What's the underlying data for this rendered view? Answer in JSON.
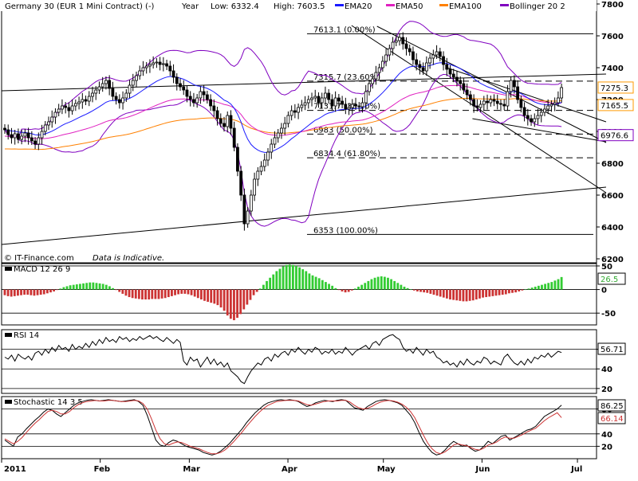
{
  "header": {
    "instrument": "Germany 30 (EUR 1 Mini Contract) (-)",
    "period": "Year",
    "low": "Low: 6332.4",
    "high": "High: 7603.5",
    "legend": [
      {
        "label": "EMA20",
        "color": "#1a1aff"
      },
      {
        "label": "EMA50",
        "color": "#e020c0"
      },
      {
        "label": "EMA100",
        "color": "#ff8000"
      },
      {
        "label": "Bollinger 20 2",
        "color": "#8000c0"
      }
    ]
  },
  "footer_text": {
    "copyright": "© IT-Finance.com",
    "disclaimer": "Data is Indicative."
  },
  "x_axis": {
    "labels": [
      {
        "text": "2011",
        "x": 0
      },
      {
        "text": "Feb",
        "x": 31
      },
      {
        "text": "Mar",
        "x": 59
      },
      {
        "text": "Apr",
        "x": 90
      },
      {
        "text": "May",
        "x": 120
      },
      {
        "text": "Jun",
        "x": 151
      },
      {
        "text": "Jul",
        "x": 181
      }
    ]
  },
  "chart_data": [
    {
      "type": "candlestick",
      "name": "price",
      "x_unit": "days since Jan 1 2011",
      "ylim": [
        6200,
        7800
      ],
      "yticks": [
        6200,
        6400,
        6600,
        6800,
        7000,
        7200,
        7400,
        7600,
        7800
      ],
      "price_labels": [
        {
          "text": "7275.3",
          "value": 7275.3,
          "color": "#ff9900"
        },
        {
          "text": "7165.5",
          "value": 7165.5,
          "color": "#ff9900"
        },
        {
          "text": "6976.6",
          "value": 6976.6,
          "color": "#8000c0"
        }
      ],
      "fib_levels": [
        {
          "label": "7613.1 (0.00%)",
          "value": 7613.1,
          "dashed": false
        },
        {
          "label": "7315.7 (23.60%)",
          "value": 7315.7,
          "dashed": true
        },
        {
          "label": "7131.7 (38.20%)",
          "value": 7131.7,
          "dashed": true
        },
        {
          "label": "6983 (50.00%)",
          "value": 6983,
          "dashed": true
        },
        {
          "label": "6834.4 (61.80%)",
          "value": 6834.4,
          "dashed": true
        },
        {
          "label": "6353 (100.00%)",
          "value": 6353,
          "dashed": false
        }
      ],
      "trendlines": [
        {
          "x1": 0,
          "y1": 7255,
          "x2": 190,
          "y2": 7360
        },
        {
          "x1": 0,
          "y1": 6290,
          "x2": 190,
          "y2": 6650
        },
        {
          "x1": 110,
          "y1": 7665,
          "x2": 190,
          "y2": 6615
        },
        {
          "x1": 118,
          "y1": 7660,
          "x2": 190,
          "y2": 6930
        },
        {
          "x1": 148,
          "y1": 7080,
          "x2": 190,
          "y2": 6935
        },
        {
          "x1": 140,
          "y1": 7400,
          "x2": 190,
          "y2": 7060
        }
      ],
      "close": [
        7010,
        6980,
        6960,
        6985,
        6950,
        6970,
        6990,
        6960,
        6940,
        6920,
        6960,
        7000,
        7040,
        7060,
        7090,
        7120,
        7140,
        7160,
        7150,
        7130,
        7160,
        7175,
        7185,
        7200,
        7190,
        7220,
        7240,
        7260,
        7280,
        7300,
        7320,
        7270,
        7220,
        7200,
        7180,
        7210,
        7240,
        7290,
        7320,
        7350,
        7380,
        7400,
        7410,
        7420,
        7430,
        7435,
        7420,
        7425,
        7410,
        7380,
        7340,
        7300,
        7280,
        7260,
        7220,
        7200,
        7180,
        7210,
        7250,
        7230,
        7200,
        7160,
        7130,
        7080,
        7050,
        7030,
        7100,
        7020,
        6900,
        6750,
        6600,
        6420,
        6500,
        6600,
        6700,
        6750,
        6780,
        6820,
        6870,
        6920,
        6960,
        6990,
        7020,
        7050,
        7100,
        7130,
        7120,
        7150,
        7165,
        7180,
        7200,
        7210,
        7220,
        7180,
        7210,
        7240,
        7200,
        7160,
        7210,
        7190,
        7170,
        7140,
        7150,
        7170,
        7160,
        7155,
        7180,
        7250,
        7300,
        7330,
        7370,
        7400,
        7440,
        7480,
        7520,
        7560,
        7570,
        7590,
        7550,
        7520,
        7500,
        7450,
        7420,
        7400,
        7380,
        7430,
        7460,
        7480,
        7500,
        7470,
        7420,
        7390,
        7360,
        7340,
        7320,
        7300,
        7260,
        7230,
        7200,
        7160,
        7150,
        7170,
        7190,
        7180,
        7200,
        7190,
        7175,
        7170,
        7160,
        7250,
        7320,
        7280,
        7200,
        7150,
        7100,
        7080,
        7060,
        7080,
        7100,
        7120,
        7140,
        7160,
        7170,
        7180,
        7210,
        7275
      ]
    },
    {
      "type": "bar",
      "name": "MACD 12 26 9",
      "label": "MACD 12 26 9",
      "ylim": [
        -75,
        55
      ],
      "yticks": [
        50,
        0,
        -50
      ],
      "last_label": "26.5",
      "colors": {
        "positive": "#33cc33",
        "negative": "#cc3333"
      },
      "values": [
        -12,
        -14,
        -15,
        -14,
        -13,
        -12,
        -11,
        -11,
        -12,
        -13,
        -12,
        -11,
        -10,
        -8,
        -6,
        -4,
        -1,
        2,
        5,
        7,
        9,
        10,
        11,
        12,
        13,
        14,
        15,
        15,
        14,
        13,
        12,
        10,
        7,
        3,
        -1,
        -5,
        -9,
        -13,
        -16,
        -18,
        -19,
        -20,
        -21,
        -21,
        -21,
        -20,
        -20,
        -20,
        -19,
        -18,
        -16,
        -14,
        -12,
        -10,
        -9,
        -9,
        -10,
        -12,
        -15,
        -18,
        -21,
        -24,
        -26,
        -28,
        -30,
        -33,
        -38,
        -45,
        -55,
        -62,
        -65,
        -60,
        -52,
        -42,
        -32,
        -22,
        -12,
        -5,
        2,
        10,
        18,
        25,
        32,
        39,
        44,
        49,
        52,
        53,
        52,
        50,
        47,
        43,
        39,
        34,
        30,
        27,
        24,
        20,
        16,
        12,
        8,
        3,
        -1,
        -4,
        -6,
        -5,
        -2,
        2,
        6,
        10,
        14,
        18,
        22,
        25,
        27,
        28,
        27,
        25,
        22,
        18,
        14,
        10,
        6,
        3,
        0,
        -2,
        -4,
        -5,
        -6,
        -7,
        -9,
        -11,
        -13,
        -15,
        -17,
        -19,
        -21,
        -22,
        -23,
        -24,
        -25,
        -25,
        -24,
        -23,
        -21,
        -19,
        -17,
        -16,
        -15,
        -14,
        -13,
        -12,
        -11,
        -10,
        -8,
        -7,
        -6,
        -4,
        -2,
        0,
        2,
        4,
        6,
        8,
        10,
        12,
        14,
        16,
        19,
        22,
        26.5
      ]
    },
    {
      "type": "line",
      "name": "RSI 14",
      "label": "RSI 14",
      "ylim": [
        15,
        80
      ],
      "yticks": [
        60,
        40,
        20
      ],
      "last_label": "56.71",
      "color": "#000000",
      "values": [
        52,
        50,
        54,
        48,
        55,
        52,
        50,
        53,
        49,
        56,
        58,
        54,
        60,
        56,
        62,
        58,
        64,
        60,
        62,
        58,
        65,
        60,
        63,
        61,
        66,
        62,
        68,
        64,
        70,
        66,
        72,
        68,
        70,
        67,
        73,
        70,
        72,
        68,
        71,
        69,
        73,
        70,
        72,
        74,
        71,
        73,
        70,
        68,
        72,
        69,
        66,
        70,
        67,
        48,
        44,
        52,
        48,
        50,
        42,
        47,
        52,
        45,
        50,
        44,
        47,
        42,
        46,
        38,
        35,
        32,
        27,
        25,
        32,
        38,
        42,
        46,
        44,
        50,
        52,
        48,
        55,
        52,
        56,
        58,
        54,
        60,
        57,
        62,
        58,
        55,
        60,
        57,
        62,
        60,
        55,
        58,
        56,
        60,
        55,
        58,
        56,
        62,
        58,
        54,
        58,
        60,
        62,
        64,
        60,
        66,
        68,
        64,
        70,
        72,
        74,
        75,
        72,
        70,
        62,
        58,
        60,
        56,
        62,
        58,
        54,
        60,
        56,
        58,
        52,
        50,
        46,
        48,
        44,
        46,
        42,
        48,
        44,
        50,
        46,
        44,
        48,
        46,
        52,
        50,
        45,
        48,
        46,
        44,
        52,
        55,
        50,
        46,
        44,
        48,
        44,
        50,
        46,
        52,
        50,
        54,
        52,
        56,
        52,
        55,
        58,
        56.71
      ]
    },
    {
      "type": "line",
      "name": "Stochastic 14 3 5",
      "label": "Stochastic 14 3 5",
      "ylim": [
        0,
        100
      ],
      "yticks": [
        80,
        40,
        20
      ],
      "last_labels": [
        {
          "text": "86.25",
          "color": "#000000"
        },
        {
          "text": "66.14",
          "color": "#cc3333"
        }
      ],
      "series": [
        {
          "name": "%K",
          "color": "#000000",
          "values": [
            30,
            25,
            20,
            35,
            40,
            48,
            55,
            62,
            68,
            75,
            80,
            78,
            72,
            68,
            74,
            80,
            86,
            90,
            92,
            94,
            95,
            94,
            93,
            94,
            95,
            94,
            93,
            92,
            93,
            94,
            95,
            92,
            86,
            70,
            50,
            30,
            22,
            20,
            26,
            30,
            28,
            24,
            20,
            18,
            16,
            14,
            10,
            8,
            6,
            8,
            12,
            18,
            24,
            32,
            40,
            48,
            58,
            66,
            74,
            80,
            86,
            90,
            92,
            94,
            95,
            94,
            95,
            94,
            92,
            88,
            84,
            86,
            90,
            92,
            94,
            93,
            92,
            94,
            95,
            94,
            88,
            82,
            80,
            78,
            84,
            88,
            92,
            94,
            95,
            94,
            92,
            90,
            86,
            78,
            70,
            58,
            42,
            28,
            18,
            10,
            6,
            8,
            14,
            22,
            28,
            24,
            20,
            22,
            16,
            12,
            14,
            20,
            28,
            24,
            30,
            36,
            38,
            30,
            34,
            38,
            42,
            46,
            48,
            52,
            60,
            68,
            72,
            76,
            80,
            86.25
          ]
        },
        {
          "name": "%D",
          "color": "#cc3333",
          "values": [
            32,
            28,
            24,
            28,
            34,
            42,
            50,
            57,
            63,
            70,
            76,
            78,
            76,
            72,
            72,
            76,
            82,
            87,
            90,
            92,
            93,
            94,
            93,
            93,
            94,
            94,
            93,
            92,
            92,
            93,
            94,
            93,
            89,
            80,
            64,
            46,
            32,
            24,
            22,
            25,
            27,
            26,
            23,
            20,
            18,
            16,
            13,
            10,
            8,
            8,
            10,
            14,
            20,
            27,
            35,
            43,
            52,
            60,
            68,
            75,
            81,
            86,
            89,
            92,
            93,
            94,
            94,
            94,
            93,
            90,
            87,
            86,
            88,
            90,
            92,
            93,
            93,
            93,
            94,
            94,
            91,
            86,
            82,
            80,
            81,
            84,
            88,
            91,
            93,
            94,
            93,
            91,
            88,
            83,
            76,
            66,
            52,
            38,
            25,
            16,
            10,
            8,
            11,
            16,
            22,
            24,
            22,
            21,
            18,
            15,
            14,
            17,
            22,
            24,
            27,
            32,
            35,
            33,
            33,
            36,
            39,
            43,
            46,
            49,
            55,
            61,
            66,
            70,
            74,
            66.14
          ]
        }
      ]
    }
  ]
}
